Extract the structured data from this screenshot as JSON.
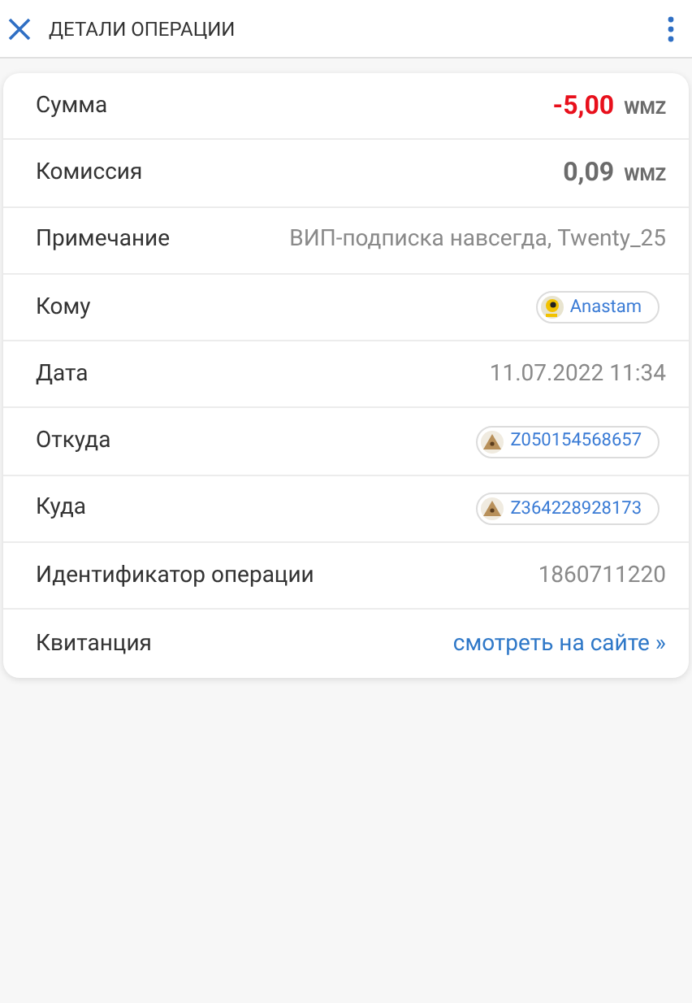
{
  "header": {
    "title": "ДЕТАЛИ ОПЕРАЦИИ"
  },
  "rows": [
    {
      "kind": "amount",
      "label": "Сумма",
      "value": "-5,00",
      "currency": "WMZ",
      "negative": true
    },
    {
      "kind": "amount",
      "label": "Комиссия",
      "value": "0,09",
      "currency": "WMZ",
      "negative": false
    },
    {
      "kind": "text",
      "label": "Примечание",
      "value": "ВИП-подписка навсегда, Twenty_25"
    },
    {
      "kind": "user",
      "label": "Кому",
      "value": "Anastam"
    },
    {
      "kind": "text",
      "label": "Дата",
      "value": "11.07.2022 11:34"
    },
    {
      "kind": "wallet",
      "label": "Откуда",
      "value": "Z050154568657"
    },
    {
      "kind": "wallet",
      "label": "Куда",
      "value": "Z364228928173"
    },
    {
      "kind": "text",
      "label": "Идентификатор операции",
      "value": "1860711220"
    },
    {
      "kind": "link",
      "label": "Квитанция",
      "value": "смотреть на сайте »"
    }
  ]
}
